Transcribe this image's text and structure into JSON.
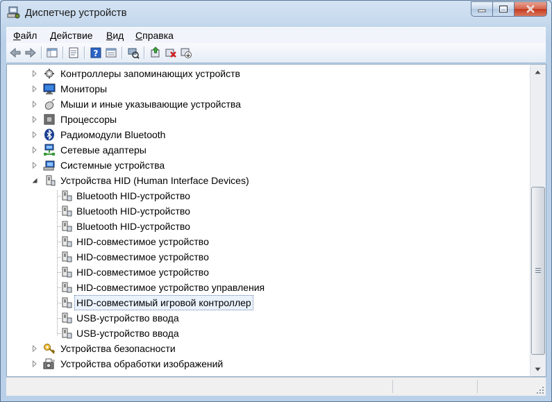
{
  "window": {
    "title": "Диспетчер устройств"
  },
  "menu": [
    {
      "label": "Файл",
      "accel": "Ф",
      "rest": "айл"
    },
    {
      "label": "Действие",
      "accel": "Д",
      "rest": "ействие"
    },
    {
      "label": "Вид",
      "accel": "В",
      "rest": "ид"
    },
    {
      "label": "Справка",
      "accel": "С",
      "rest": "правка"
    }
  ],
  "toolbar": [
    "back-icon",
    "forward-icon",
    "console-tree-icon",
    "properties-icon",
    "help-icon",
    "view-icon",
    "scan-hardware-icon",
    "update-driver-icon",
    "uninstall-icon",
    "disable-device-icon"
  ],
  "tree": {
    "categories_top": [
      {
        "label": "Контроллеры запоминающих устройств",
        "icon": "storage-controller-icon"
      },
      {
        "label": "Мониторы",
        "icon": "monitor-icon"
      },
      {
        "label": "Мыши и иные указывающие устройства",
        "icon": "mouse-icon"
      },
      {
        "label": "Процессоры",
        "icon": "processor-icon"
      },
      {
        "label": "Радиомодули Bluetooth",
        "icon": "bluetooth-icon"
      },
      {
        "label": "Сетевые адаптеры",
        "icon": "network-adapter-icon"
      },
      {
        "label": "Системные устройства",
        "icon": "system-device-icon"
      }
    ],
    "expanded": {
      "label": "Устройства HID (Human Interface Devices)",
      "icon": "hid-icon"
    },
    "children": [
      {
        "label": "Bluetooth HID-устройство"
      },
      {
        "label": "Bluetooth HID-устройство"
      },
      {
        "label": "Bluetooth HID-устройство"
      },
      {
        "label": "HID-совместимое устройство"
      },
      {
        "label": "HID-совместимое устройство"
      },
      {
        "label": "HID-совместимое устройство"
      },
      {
        "label": "HID-совместимое устройство управления"
      },
      {
        "label": "HID-совместимый игровой контроллер",
        "selected": true
      },
      {
        "label": "USB-устройство ввода"
      },
      {
        "label": "USB-устройство ввода"
      }
    ],
    "categories_bottom": [
      {
        "label": "Устройства безопасности",
        "icon": "security-device-icon"
      },
      {
        "label": "Устройства обработки изображений",
        "icon": "imaging-device-icon"
      }
    ]
  },
  "colors": {
    "selection_bg": "#eaf2fc",
    "frame": "#b9d0e8",
    "close_button": "#c5391d"
  }
}
